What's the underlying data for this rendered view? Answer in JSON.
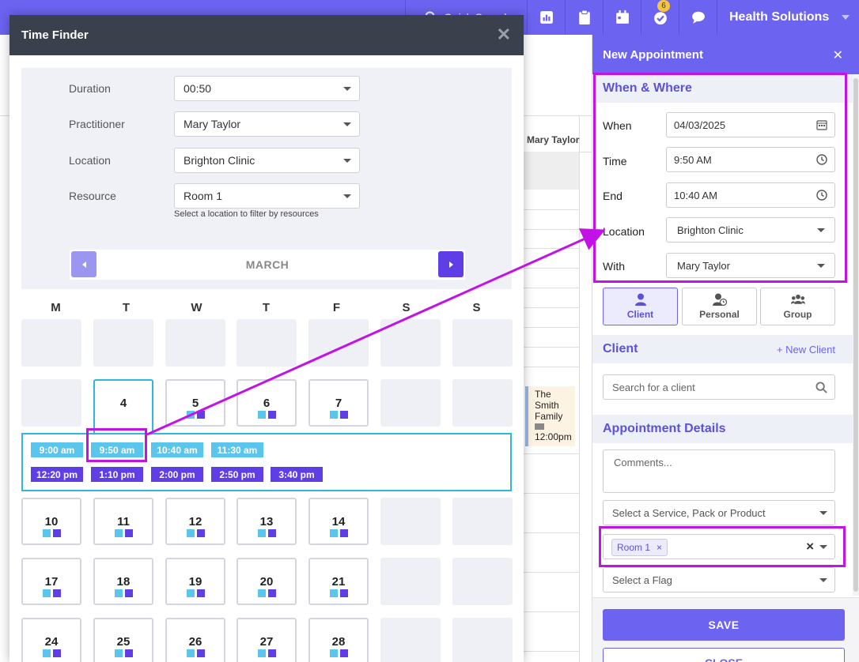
{
  "topbar": {
    "quick_search": "Quick Search",
    "badge_count": "6",
    "brand": "Health Solutions",
    "icons": [
      "chart-icon",
      "clipboard-icon",
      "calendar-icon",
      "check-icon",
      "chat-icon"
    ]
  },
  "background": {
    "col_label": "Mary Taylor",
    "event_lines": [
      "The",
      "Smith",
      "Family",
      "12:00pm"
    ]
  },
  "time_finder": {
    "title": "Time Finder",
    "close": "✕",
    "fields": {
      "duration": {
        "label": "Duration",
        "value": "00:50"
      },
      "practitioner": {
        "label": "Practitioner",
        "value": "Mary Taylor"
      },
      "location": {
        "label": "Location",
        "value": "Brighton Clinic"
      },
      "resource": {
        "label": "Resource",
        "value": "Room 1"
      }
    },
    "hint": "Select a location to filter by resources",
    "month": "MARCH",
    "weekdays": [
      "M",
      "T",
      "W",
      "T",
      "F",
      "S",
      "S"
    ],
    "week2_days": [
      "4",
      "5",
      "6",
      "7"
    ],
    "slots_am": [
      "9:00 am",
      "9:50 am",
      "10:40 am",
      "11:30 am"
    ],
    "slots_pm": [
      "12:20 pm",
      "1:10 pm",
      "2:00 pm",
      "2:50 pm",
      "3:40 pm"
    ],
    "week3_days": [
      "10",
      "11",
      "12",
      "13",
      "14"
    ],
    "week4_days": [
      "17",
      "18",
      "19",
      "20",
      "21"
    ],
    "week5_days": [
      "24",
      "25",
      "26",
      "27",
      "28"
    ]
  },
  "appointment": {
    "title": "New Appointment",
    "close": "✕",
    "when_where": {
      "heading": "When & Where",
      "when": {
        "label": "When",
        "value": "04/03/2025"
      },
      "time": {
        "label": "Time",
        "value": "9:50 AM"
      },
      "end": {
        "label": "End",
        "value": "10:40 AM"
      },
      "location": {
        "label": "Location",
        "value": "Brighton Clinic"
      },
      "with": {
        "label": "With",
        "value": "Mary Taylor"
      }
    },
    "types": {
      "client": "Client",
      "personal": "Personal",
      "group": "Group"
    },
    "client": {
      "heading": "Client",
      "new_client": "+ New Client",
      "search_placeholder": "Search for a client"
    },
    "details": {
      "heading": "Appointment Details",
      "comments_placeholder": "Comments...",
      "service_placeholder": "Select a Service, Pack or Product",
      "resource_tag": "Room 1",
      "flag_placeholder": "Select a Flag"
    },
    "save": "SAVE",
    "close_label": "CLOSE"
  },
  "colors": {
    "brand": "#6c63f0",
    "slot_am": "#5bc6ec",
    "slot_pm": "#5f3ee6",
    "highlight": "#c312e6"
  }
}
